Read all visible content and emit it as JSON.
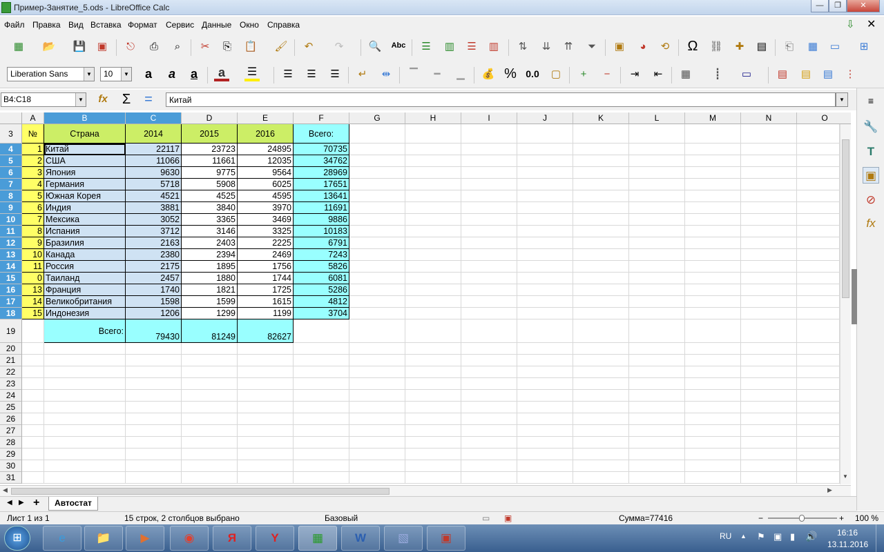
{
  "window": {
    "title": "Пример-Занятие_5.ods - LibreOffice Calc"
  },
  "menu": [
    "Файл",
    "Правка",
    "Вид",
    "Вставка",
    "Формат",
    "Сервис",
    "Данные",
    "Окно",
    "Справка"
  ],
  "format": {
    "font_name": "Liberation Sans",
    "font_size": "10"
  },
  "formula_bar": {
    "name_box": "B4:C18",
    "content": "Китай"
  },
  "columns": [
    "A",
    "B",
    "C",
    "D",
    "E",
    "F",
    "G",
    "H",
    "I",
    "J",
    "K",
    "L",
    "M",
    "N",
    "O"
  ],
  "header_row": {
    "row": "3",
    "num": "№",
    "country": "Страна",
    "y2014": "2014",
    "y2015": "2015",
    "y2016": "2016",
    "total": "Всего:"
  },
  "rows": [
    {
      "r": "4",
      "n": "1",
      "c": "Китай",
      "a": "22117",
      "b": "23723",
      "d": "24895",
      "t": "70735"
    },
    {
      "r": "5",
      "n": "2",
      "c": "США",
      "a": "11066",
      "b": "11661",
      "d": "12035",
      "t": "34762"
    },
    {
      "r": "6",
      "n": "3",
      "c": "Япония",
      "a": "9630",
      "b": "9775",
      "d": "9564",
      "t": "28969"
    },
    {
      "r": "7",
      "n": "4",
      "c": "Германия",
      "a": "5718",
      "b": "5908",
      "d": "6025",
      "t": "17651"
    },
    {
      "r": "8",
      "n": "5",
      "c": "Южная Корея",
      "a": "4521",
      "b": "4525",
      "d": "4595",
      "t": "13641"
    },
    {
      "r": "9",
      "n": "6",
      "c": "Индия",
      "a": "3881",
      "b": "3840",
      "d": "3970",
      "t": "11691"
    },
    {
      "r": "10",
      "n": "7",
      "c": "Мексика",
      "a": "3052",
      "b": "3365",
      "d": "3469",
      "t": "9886"
    },
    {
      "r": "11",
      "n": "8",
      "c": "Испания",
      "a": "3712",
      "b": "3146",
      "d": "3325",
      "t": "10183"
    },
    {
      "r": "12",
      "n": "9",
      "c": "Бразилия",
      "a": "2163",
      "b": "2403",
      "d": "2225",
      "t": "6791"
    },
    {
      "r": "13",
      "n": "10",
      "c": "Канада",
      "a": "2380",
      "b": "2394",
      "d": "2469",
      "t": "7243"
    },
    {
      "r": "14",
      "n": "11",
      "c": "Россия",
      "a": "2175",
      "b": "1895",
      "d": "1756",
      "t": "5826"
    },
    {
      "r": "15",
      "n": "0",
      "c": "Таиланд",
      "a": "2457",
      "b": "1880",
      "d": "1744",
      "t": "6081"
    },
    {
      "r": "16",
      "n": "13",
      "c": "Франция",
      "a": "1740",
      "b": "1821",
      "d": "1725",
      "t": "5286"
    },
    {
      "r": "17",
      "n": "14",
      "c": "Великобритания",
      "a": "1598",
      "b": "1599",
      "d": "1615",
      "t": "4812"
    },
    {
      "r": "18",
      "n": "15",
      "c": "Индонезия",
      "a": "1206",
      "b": "1299",
      "d": "1199",
      "t": "3704"
    }
  ],
  "totals_row": {
    "row": "19",
    "label": "Всего:",
    "y2014": "79430",
    "y2015": "81249",
    "y2016": "82627"
  },
  "empty_rows": [
    "20",
    "21",
    "22",
    "23",
    "24",
    "25",
    "26",
    "27",
    "28",
    "29",
    "30",
    "31"
  ],
  "sheet_tab": "Автостат",
  "status": {
    "sheet": "Лист 1 из 1",
    "selection": "15 строк, 2 столбцов выбрано",
    "style": "Базовый",
    "sum": "Сумма=77416",
    "zoom": "100 %"
  },
  "taskbar": {
    "lang": "RU",
    "time": "16:16",
    "date": "13.11.2016"
  },
  "colors": {
    "yellow": "#ffff66",
    "green": "#ccee66",
    "cyan": "#99ffff",
    "selection": "#cfe2f3",
    "header_sel": "#4a9cd8"
  }
}
